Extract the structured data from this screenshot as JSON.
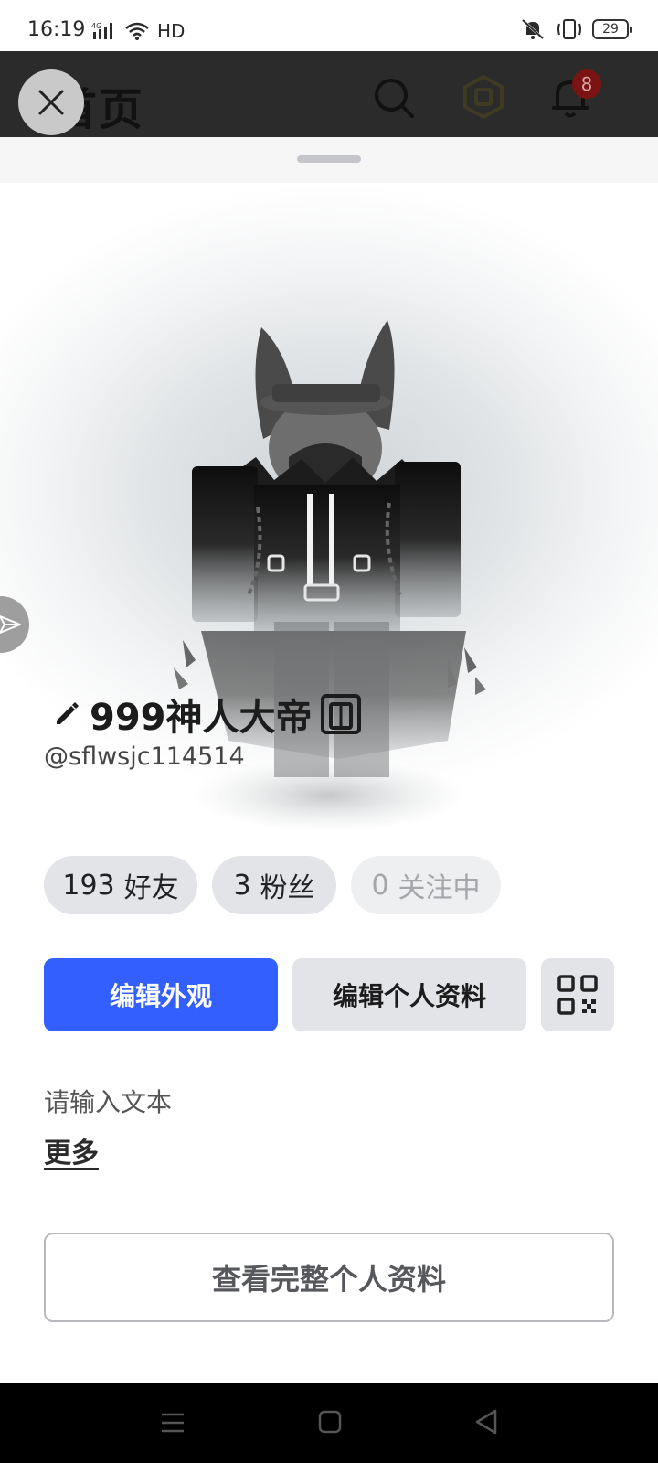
{
  "status_bar": {
    "time": "16:19",
    "network": "4G",
    "hd": "HD",
    "battery": "29",
    "icons": [
      "signal-icon",
      "wifi-icon",
      "vibrate-mute-icon",
      "vibrate-icon",
      "battery-icon"
    ]
  },
  "header": {
    "title": "首页",
    "icons": [
      "close-icon",
      "search-icon",
      "robux-icon",
      "bell-icon"
    ],
    "notification_count": "8"
  },
  "profile": {
    "display_name": "999神人大帝",
    "username": "@sflwsjc114514",
    "stats": {
      "friends": {
        "count": "193",
        "label": "好友"
      },
      "fans": {
        "count": "3",
        "label": "粉丝"
      },
      "following": {
        "count": "0",
        "label": "关注中"
      }
    },
    "edit_avatar_label": "编辑外观",
    "edit_profile_label": "编辑个人资料",
    "bio": "请输入文本",
    "more_label": "更多",
    "view_full_profile_label": "查看完整个人资料"
  },
  "colors": {
    "primary_button": "#335fff",
    "chip_bg": "#e3e4e8",
    "header_bg": "#2b2b2b",
    "badge": "#7a1414"
  },
  "nav_bar": {
    "icons": [
      "menu-icon",
      "home-icon",
      "back-icon"
    ]
  }
}
